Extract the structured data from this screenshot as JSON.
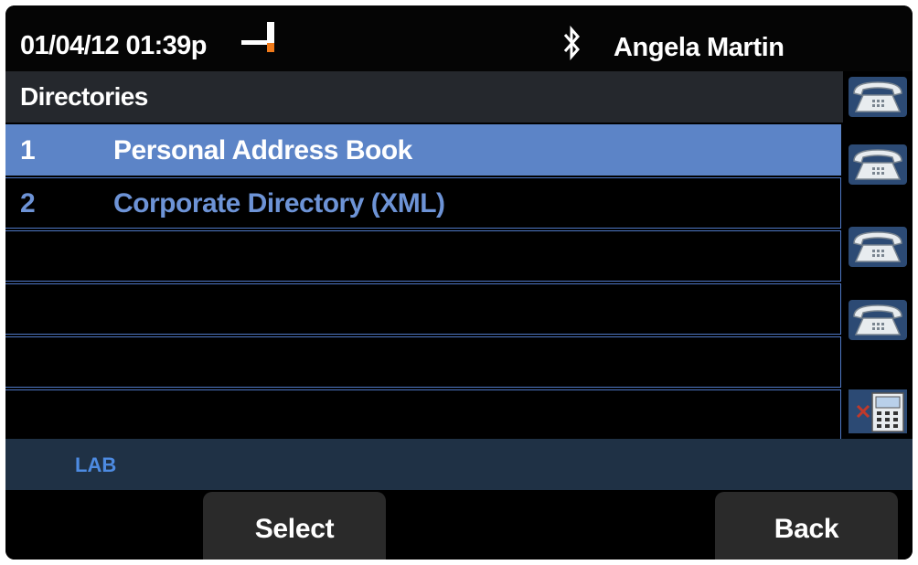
{
  "header": {
    "datetime": "01/04/12 01:39p",
    "status_icon": "handset-status-icon",
    "bluetooth_icon": "bluetooth-icon",
    "user_name": "Angela Martin"
  },
  "directory": {
    "title": "Directories",
    "items": [
      {
        "number": "1",
        "label": "Personal Address Book",
        "selected": true
      },
      {
        "number": "2",
        "label": "Corporate Directory (XML)",
        "selected": false
      },
      {
        "number": "",
        "label": "",
        "selected": false
      },
      {
        "number": "",
        "label": "",
        "selected": false
      },
      {
        "number": "",
        "label": "",
        "selected": false
      },
      {
        "number": "",
        "label": "",
        "selected": false
      }
    ]
  },
  "footer": {
    "label": "LAB"
  },
  "softkeys": [
    {
      "label": "Select"
    },
    {
      "label": "Back"
    }
  ],
  "line_buttons": [
    "line-phone-icon",
    "line-phone-icon",
    "line-phone-icon",
    "line-phone-icon",
    "keypad-x-icon"
  ],
  "colors": {
    "selected_row": "#5c84c7",
    "item_text": "#6d93d6",
    "footer_text": "#4d8be2",
    "title_bar": "#25282d"
  }
}
